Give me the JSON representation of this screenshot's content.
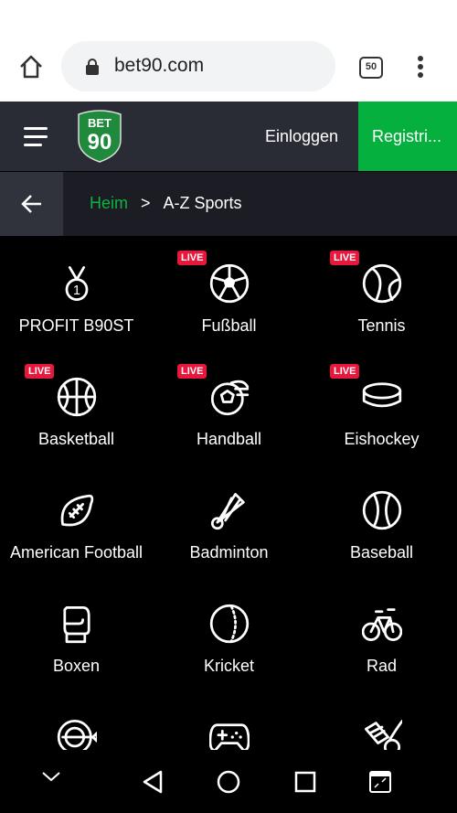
{
  "browser": {
    "url": "bet90.com",
    "tab_count": "50"
  },
  "header": {
    "logo_text": "BET 90",
    "login_label": "Einloggen",
    "register_label": "Registri..."
  },
  "breadcrumb": {
    "home": "Heim",
    "separator": ">",
    "current": "A-Z Sports"
  },
  "live_badge": "LIVE",
  "sports": [
    {
      "label": "PROFIT B90ST",
      "icon": "medal-icon",
      "live": false
    },
    {
      "label": "Fußball",
      "icon": "soccer-ball-icon",
      "live": true
    },
    {
      "label": "Tennis",
      "icon": "tennis-ball-icon",
      "live": true
    },
    {
      "label": "Basketball",
      "icon": "basketball-icon",
      "live": true
    },
    {
      "label": "Handball",
      "icon": "handball-icon",
      "live": true
    },
    {
      "label": "Eishockey",
      "icon": "hockey-puck-icon",
      "live": true
    },
    {
      "label": "American Football",
      "icon": "american-football-icon",
      "live": false
    },
    {
      "label": "Badminton",
      "icon": "shuttlecock-icon",
      "live": false
    },
    {
      "label": "Baseball",
      "icon": "baseball-icon",
      "live": false
    },
    {
      "label": "Boxen",
      "icon": "boxing-glove-icon",
      "live": false
    },
    {
      "label": "Kricket",
      "icon": "cricket-ball-icon",
      "live": false
    },
    {
      "label": "Rad",
      "icon": "bicycle-icon",
      "live": false
    },
    {
      "label": "",
      "icon": "darts-icon",
      "live": false
    },
    {
      "label": "",
      "icon": "gamepad-icon",
      "live": false
    },
    {
      "label": "",
      "icon": "table-soccer-icon",
      "live": false
    }
  ],
  "colors": {
    "brand_green": "#06b03e",
    "live_red": "#e8173c",
    "header_bg": "#2a2c35"
  }
}
